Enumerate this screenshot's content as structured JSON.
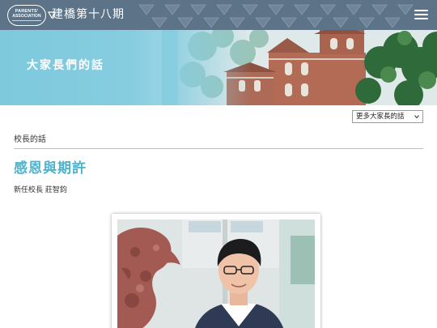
{
  "header": {
    "site_title": "建橋第十八期",
    "logo_line1": "PARENTS'",
    "logo_line2": "ASSOCIATION",
    "menu_icon": "hamburger-menu-icon"
  },
  "banner": {
    "title": "大家長們的話"
  },
  "selector": {
    "selected": "更多大家長的話"
  },
  "content": {
    "section_label": "校長的話",
    "article_title": "感恩與期許",
    "author": "新任校長 莊智鈞"
  },
  "colors": {
    "header_bg": "#5c7388",
    "banner_bg": "#86cde0",
    "accent": "#4fb3cf",
    "rule": "#8fcfe0"
  }
}
